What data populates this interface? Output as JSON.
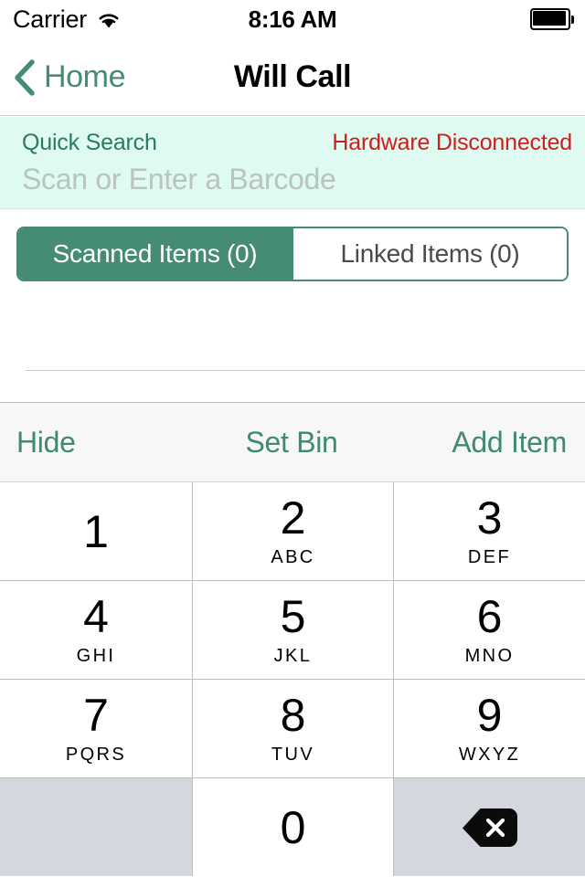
{
  "status_bar": {
    "carrier": "Carrier",
    "wifi_icon": "wifi-icon",
    "time": "8:16 AM",
    "battery_icon": "battery-full-icon"
  },
  "nav_bar": {
    "back_icon": "chevron-left-icon",
    "back_label": "Home",
    "title": "Will Call"
  },
  "quick_search": {
    "label": "Quick Search",
    "hardware_status": "Hardware Disconnected",
    "input_value": "",
    "input_placeholder": "Scan or Enter a Barcode"
  },
  "segmented_control": {
    "segments": [
      {
        "label": "Scanned Items (0)",
        "selected": true
      },
      {
        "label": "Linked Items (0)",
        "selected": false
      }
    ]
  },
  "accessory_toolbar": {
    "hide_label": "Hide",
    "set_bin_label": "Set Bin",
    "add_item_label": "Add Item"
  },
  "keypad": {
    "keys": [
      {
        "digit": "1",
        "letters": ""
      },
      {
        "digit": "2",
        "letters": "ABC"
      },
      {
        "digit": "3",
        "letters": "DEF"
      },
      {
        "digit": "4",
        "letters": "GHI"
      },
      {
        "digit": "5",
        "letters": "JKL"
      },
      {
        "digit": "6",
        "letters": "MNO"
      },
      {
        "digit": "7",
        "letters": "PQRS"
      },
      {
        "digit": "8",
        "letters": "TUV"
      },
      {
        "digit": "9",
        "letters": "WXYZ"
      },
      {
        "digit": "",
        "letters": ""
      },
      {
        "digit": "0",
        "letters": ""
      },
      {
        "digit": "",
        "letters": "",
        "icon": "backspace-icon"
      }
    ]
  },
  "colors": {
    "accent_green": "#458c72",
    "label_green": "#2d7a5f",
    "error_red": "#cc2020",
    "search_background": "#dffaf0",
    "key_gray": "#d4d7de",
    "toolbar_gray": "#f7f7f7"
  }
}
